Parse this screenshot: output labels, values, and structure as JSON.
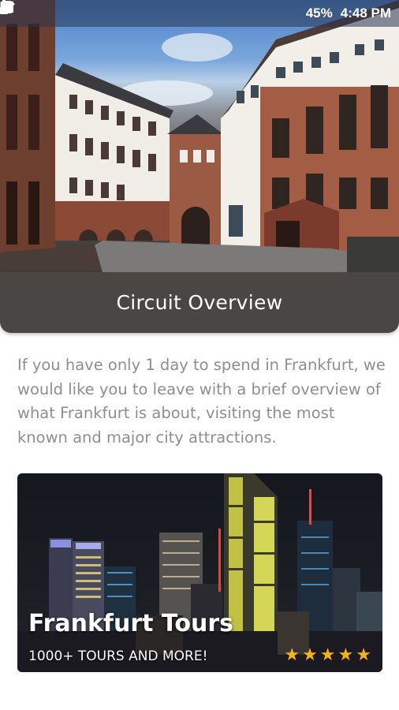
{
  "status_bar": {
    "battery": "45%",
    "time": "4:48 PM",
    "icons": [
      "notification-icon",
      "location-icon",
      "wifi-icon",
      "signal-icon",
      "battery-icon"
    ]
  },
  "hero": {
    "image": "frankfurt-courtyard-photo"
  },
  "circuit": {
    "title": "Circuit Overview",
    "description": "If you have only 1 day to spend in Frankfurt, we would like you to leave with a brief overview of what Frankfurt is about, visiting the most known and major city attractions."
  },
  "banner": {
    "image": "frankfurt-skyline-night-photo",
    "title": "Frankfurt Tours",
    "subtitle": "1000+ TOURS AND MORE!",
    "rating": 5,
    "star_color": "#f2b21b"
  },
  "colors": {
    "title_bar": "#4a4643",
    "description_text": "#8e8e8e"
  }
}
